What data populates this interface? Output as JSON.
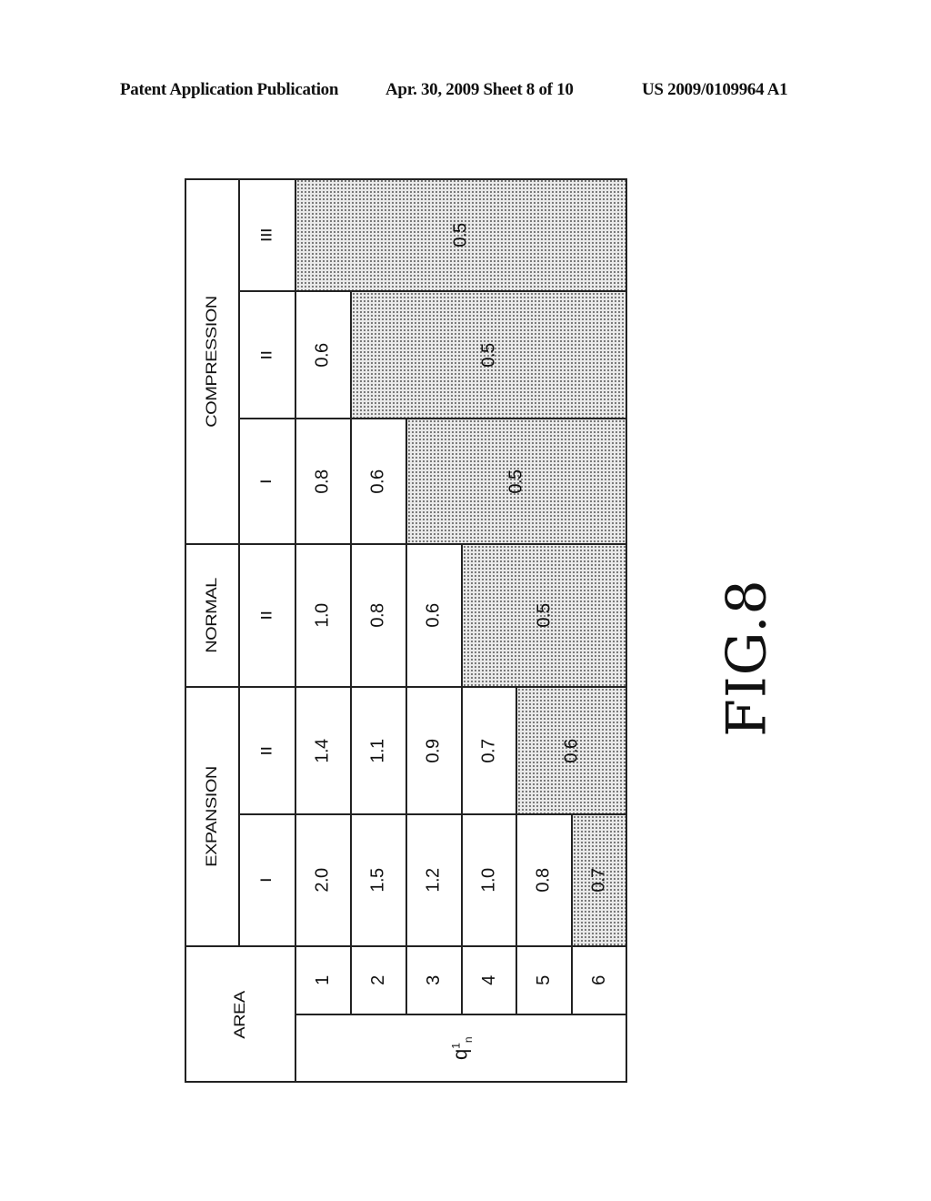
{
  "header": {
    "left": "Patent Application Publication",
    "middle": "Apr. 30, 2009  Sheet 8 of 10",
    "right": "US 2009/0109964 A1"
  },
  "table": {
    "area_label": "AREA",
    "coefficient_label": "q",
    "coefficient_superscript": "1",
    "coefficient_subscript": "n",
    "areas": [
      "1",
      "2",
      "3",
      "4",
      "5",
      "6"
    ],
    "groups": [
      {
        "name": "EXPANSION",
        "columns": [
          {
            "sub": "I",
            "values": [
              "2.0",
              "1.5",
              "1.2",
              "1.0",
              "0.8",
              "0.7"
            ],
            "shaded_from": 6
          },
          {
            "sub": "II",
            "values": [
              "1.4",
              "1.1",
              "0.9",
              "0.7",
              "0.6",
              ""
            ],
            "shaded_from": 5
          }
        ]
      },
      {
        "name": "NORMAL",
        "columns": [
          {
            "sub": "II",
            "values": [
              "1.0",
              "0.8",
              "0.6",
              "0.5",
              "",
              ""
            ],
            "shaded_from": 4
          }
        ]
      },
      {
        "name": "COMPRESSION",
        "columns": [
          {
            "sub": "I",
            "values": [
              "0.8",
              "0.6",
              "0.5",
              "",
              "",
              ""
            ],
            "shaded_from": 3
          },
          {
            "sub": "II",
            "values": [
              "0.6",
              "0.5",
              "",
              "",
              "",
              ""
            ],
            "shaded_from": 2
          },
          {
            "sub": "III",
            "values": [
              "0.5",
              "",
              "",
              "",
              "",
              ""
            ],
            "shaded_from": 1
          }
        ]
      }
    ]
  },
  "figure_label": "FIG.8"
}
